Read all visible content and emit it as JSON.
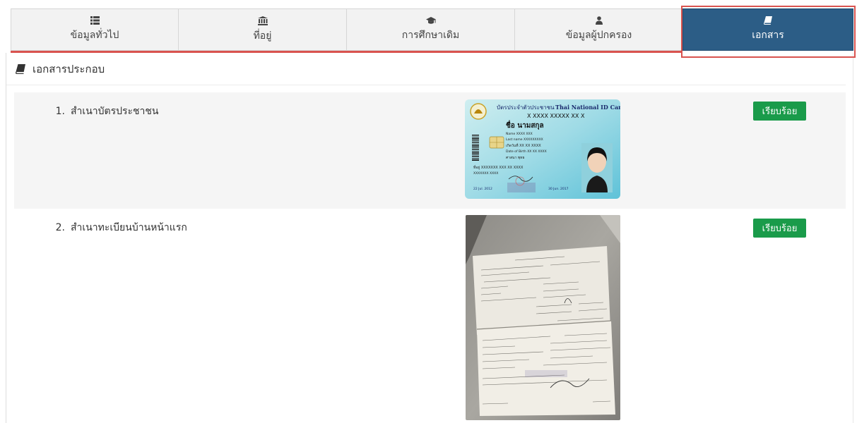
{
  "tabs": [
    {
      "label": "ข้อมูลทั่วไป",
      "icon": "list-icon",
      "active": false
    },
    {
      "label": "ที่อยู่",
      "icon": "bank-building-icon",
      "active": false
    },
    {
      "label": "การศึกษาเดิม",
      "icon": "graduation-cap-icon",
      "active": false
    },
    {
      "label": "ข้อมูลผู้ปกครอง",
      "icon": "user-icon",
      "active": false
    },
    {
      "label": "เอกสาร",
      "icon": "book-icon",
      "active": true
    }
  ],
  "section": {
    "title": "เอกสารประกอบ",
    "icon": "book-icon"
  },
  "documents": [
    {
      "number": "1.",
      "name": "สำเนาบัตรประชาชน",
      "status": "เรียบร้อย",
      "card": {
        "title_th": "บัตรประจำตัวประชาชน",
        "title_en": "Thai National ID Card",
        "id_number": "X XXXX XXXXX XX X",
        "name_th": "ชื่อ นามสกุล",
        "name_en": "Name XXXX XXX",
        "last_name": "Last name XXXXXXXXX",
        "dob_th": "เกิดวันที่ XX XX XXXX",
        "dob_en": "Date of Birth XX XX XXXX",
        "religion": "ศาสนา พุทธ",
        "address": "ที่อยู่ XXXXXXX XXX XX XXXX",
        "address2": "XXXXXXX XXXX",
        "issue_date": "22 Jul. 2012",
        "expiry_date": "30 Jun. 2017"
      }
    },
    {
      "number": "2.",
      "name": "สำเนาทะเบียนบ้านหน้าแรก",
      "status": "เรียบร้อย"
    }
  ],
  "colors": {
    "active_tab": "#2c5d86",
    "highlight_red": "#d9534f",
    "badge_green": "#1a9b4a",
    "row_shade": "#f5f5f5"
  }
}
